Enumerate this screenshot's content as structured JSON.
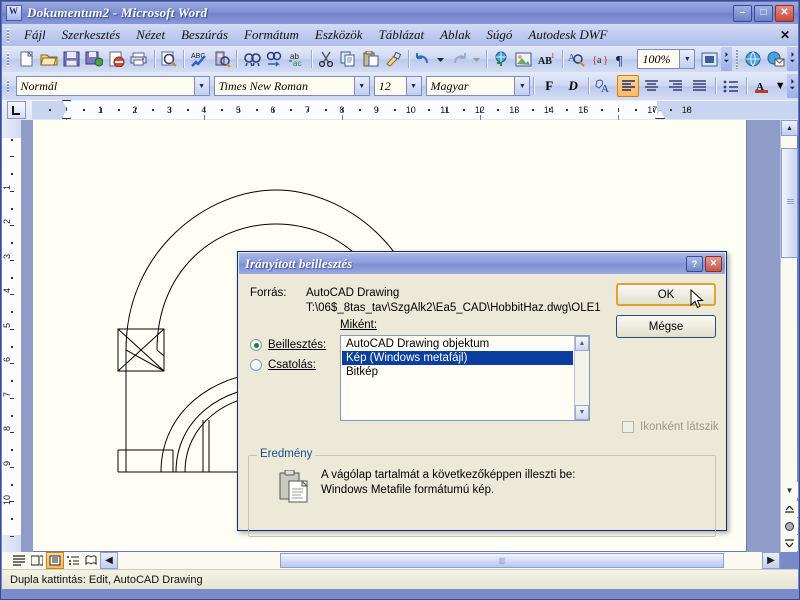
{
  "window": {
    "title": "Dokumentum2 - Microsoft Word",
    "icon": "word-icon",
    "minimize": "–",
    "maximize": "□",
    "close": "✕"
  },
  "menu": {
    "items": [
      {
        "label": "Fájl"
      },
      {
        "label": "Szerkesztés"
      },
      {
        "label": "Nézet"
      },
      {
        "label": "Beszúrás"
      },
      {
        "label": "Formátum"
      },
      {
        "label": "Eszközök"
      },
      {
        "label": "Táblázat"
      },
      {
        "label": "Ablak"
      },
      {
        "label": "Súgó"
      },
      {
        "label": "Autodesk DWF"
      }
    ],
    "close_document": "✕"
  },
  "standard_toolbar": {
    "icons": [
      "new-document-icon",
      "open-folder-icon",
      "save-icon",
      "email-icon",
      "permission-icon",
      "print-icon",
      "print-preview-icon",
      "spelling-check-icon",
      "research-icon",
      "find-icon",
      "find-next-icon",
      "replace-icon",
      "cut-icon",
      "copy-icon",
      "paste-icon",
      "format-painter-icon",
      "undo-icon",
      "undo-dropdown-icon",
      "redo-icon",
      "redo-dropdown-icon",
      "hyperlink-icon",
      "insert-picture-icon",
      "footnote-icon",
      "zoom-tool-icon",
      "style-tag-icon",
      "show-formatting-icon"
    ],
    "zoom": {
      "value": "100%",
      "dropdown": "▼"
    },
    "reading_layout_icon": "reading-layout-icon",
    "overflow": "⏷",
    "dwf_icons": [
      "autodesk-dwf-publish-icon",
      "autodesk-dwf-publish-email-icon"
    ]
  },
  "formatting_toolbar": {
    "style": {
      "value": "Normál",
      "arrow": "▼"
    },
    "font": {
      "value": "Times New Roman",
      "arrow": "▼"
    },
    "size": {
      "value": "12",
      "arrow": "▼"
    },
    "language": {
      "value": "Magyar",
      "arrow": "▼"
    },
    "bold": "F",
    "italic": "D",
    "highlight_icon": "text-highlight-icon",
    "align_left_icon": "align-left-icon",
    "align_center_icon": "align-center-icon",
    "align_right_icon": "align-right-icon",
    "align_justify_icon": "align-justify-icon",
    "bullets_icon": "bullet-list-icon",
    "font_color": {
      "letter": "A",
      "arrow": "▼"
    },
    "overflow": "⏷"
  },
  "ruler": {
    "tab_selector_icon": "tab-left-icon",
    "horizontal_ticks": [
      "1",
      "2",
      "3",
      "4",
      "5",
      "6",
      "7",
      "8",
      "9",
      "10",
      "11",
      "12",
      "13",
      "14",
      "15",
      "17",
      "18"
    ],
    "vertical_ticks": [
      "1",
      "2",
      "3",
      "4",
      "5",
      "6",
      "7",
      "8",
      "9",
      "10"
    ]
  },
  "document": {
    "content_description": "AutoCAD drawing of an arched hobbit house section"
  },
  "scrollbars": {
    "up_arrow": "▲",
    "down_arrow": "▼",
    "left_arrow": "◀",
    "right_arrow": "▶",
    "prev_page_icon": "previous-page-icon",
    "select_browse_object_icon": "select-browse-object-icon",
    "next_page_icon": "next-page-icon"
  },
  "view_buttons": {
    "normal_view_icon": "normal-view-icon",
    "web_layout_icon": "web-layout-view-icon",
    "print_layout_icon": "print-layout-view-icon",
    "outline_view_icon": "outline-view-icon",
    "reading_view_icon": "reading-view-icon"
  },
  "status_bar": {
    "text": "Dupla kattintás: Edit, AutoCAD Drawing"
  },
  "dialog": {
    "title": "Irányított beillesztés",
    "help_button": "?",
    "close_button": "✕",
    "source_label": "Forrás:",
    "source_type": "AutoCAD Drawing",
    "source_path": "T:\\06$_8tas_tav\\SzgAlk2\\Ea5_CAD\\HobbitHaz.dwg\\OLE1",
    "as_label": "Miként:",
    "paste_radio_label": "Beillesztés:",
    "link_radio_label": "Csatolás:",
    "selected_mode": "paste",
    "format_list": [
      {
        "label": "AutoCAD Drawing objektum",
        "selected": false
      },
      {
        "label": "Kép (Windows metafájl)",
        "selected": true
      },
      {
        "label": "Bitkép",
        "selected": false
      }
    ],
    "display_as_icon_label": "Ikonként látszik",
    "display_as_icon_checked": false,
    "display_as_icon_enabled": false,
    "ok_button": "OK",
    "cancel_button": "Mégse",
    "result_group_title": "Eredmény",
    "result_icon": "clipboard-paste-icon",
    "result_line1": "A vágólap tartalmát a következőképpen illeszti be:",
    "result_line2": "Windows Metafile formátumú kép.",
    "scroll_up": "▲",
    "scroll_down": "▼"
  },
  "colors": {
    "title_bar": "#8090d2",
    "dialog_face": "#ece9d8",
    "selection_blue": "#0a3fa0",
    "focus_orange": "#e79f2e",
    "page_white": "#fffef5"
  }
}
